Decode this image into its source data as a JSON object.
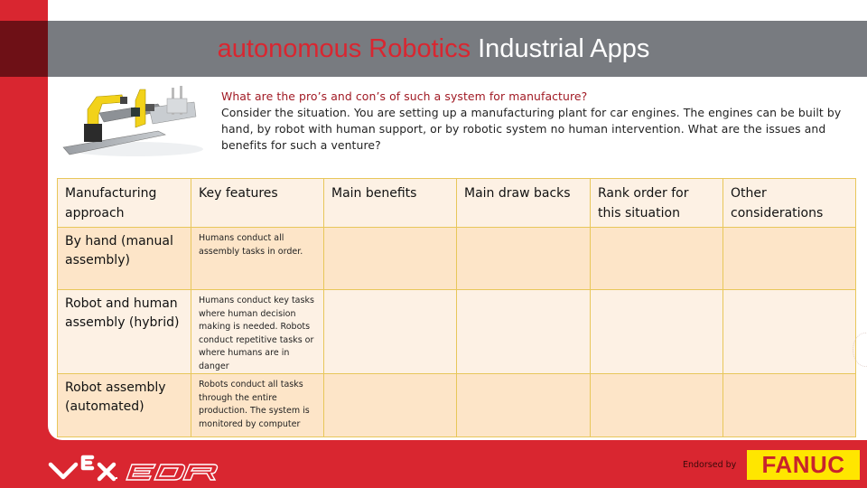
{
  "header": {
    "title_highlight": "autonomous Robotics",
    "title_rest": "Industrial Apps"
  },
  "intro": {
    "question": "What are the pro’s and con’s of such a system for manufacture?",
    "text": "Consider the situation. You are setting up a manufacturing plant for car engines. The engines can be built by hand, by robot with human support, or by robotic system no human intervention. What are the issues and benefits for such a venture?"
  },
  "image": {
    "alt": "industrial-robot-assembly-line"
  },
  "table": {
    "headers": [
      "Manufacturing approach",
      "Key features",
      "Main benefits",
      "Main draw backs",
      "Rank order for this situation",
      "Other considerations"
    ],
    "rows": [
      {
        "approach": "By hand (manual assembly)",
        "features": "Humans conduct all assembly tasks in order.",
        "benefits": "",
        "drawbacks": "",
        "rank": "",
        "other": ""
      },
      {
        "approach": "Robot and human assembly (hybrid)",
        "features": "Humans conduct key tasks where human decision making is needed. Robots conduct repetitive tasks or where humans are in danger",
        "benefits": "",
        "drawbacks": "",
        "rank": "",
        "other": ""
      },
      {
        "approach": "Robot assembly (automated)",
        "features": "Robots conduct all tasks through the entire production. The system is monitored by computer",
        "benefits": "",
        "drawbacks": "",
        "rank": "",
        "other": ""
      }
    ]
  },
  "footer": {
    "logo_vex": "VEX",
    "logo_edr": "EDR",
    "endorsed_label": "Endorsed by",
    "sponsor": "FANUC"
  },
  "colors": {
    "brand_red": "#d92630",
    "dark_red": "#6e1016",
    "band_gray": "#787b80",
    "fanuc_yellow": "#ffe600",
    "table_border": "#e8c75a"
  }
}
